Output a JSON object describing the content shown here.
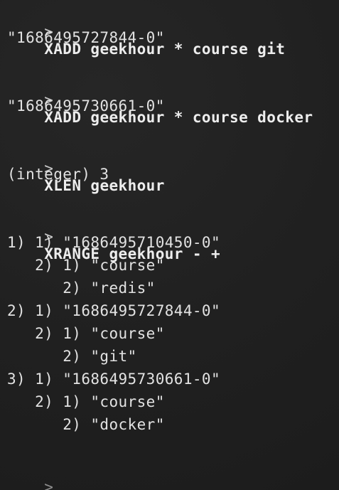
{
  "terminal": {
    "prompt_symbol": ">",
    "blocks": [
      {
        "command": "XADD geekhour * course git",
        "output": [
          "\"1686495727844-0\""
        ]
      },
      {
        "command": "XADD geekhour * course docker",
        "output": [
          "\"1686495730661-0\""
        ]
      },
      {
        "command": "XLEN geekhour",
        "output": [
          "(integer) 3"
        ]
      },
      {
        "command": "XRANGE geekhour - +",
        "output": [
          "1) 1) \"1686495710450-0\"",
          "   2) 1) \"course\"",
          "      2) \"redis\"",
          "2) 1) \"1686495727844-0\"",
          "   2) 1) \"course\"",
          "      2) \"git\"",
          "3) 1) \"1686495730661-0\"",
          "   2) 1) \"course\"",
          "      2) \"docker\""
        ]
      }
    ],
    "final_prompt": ">"
  }
}
